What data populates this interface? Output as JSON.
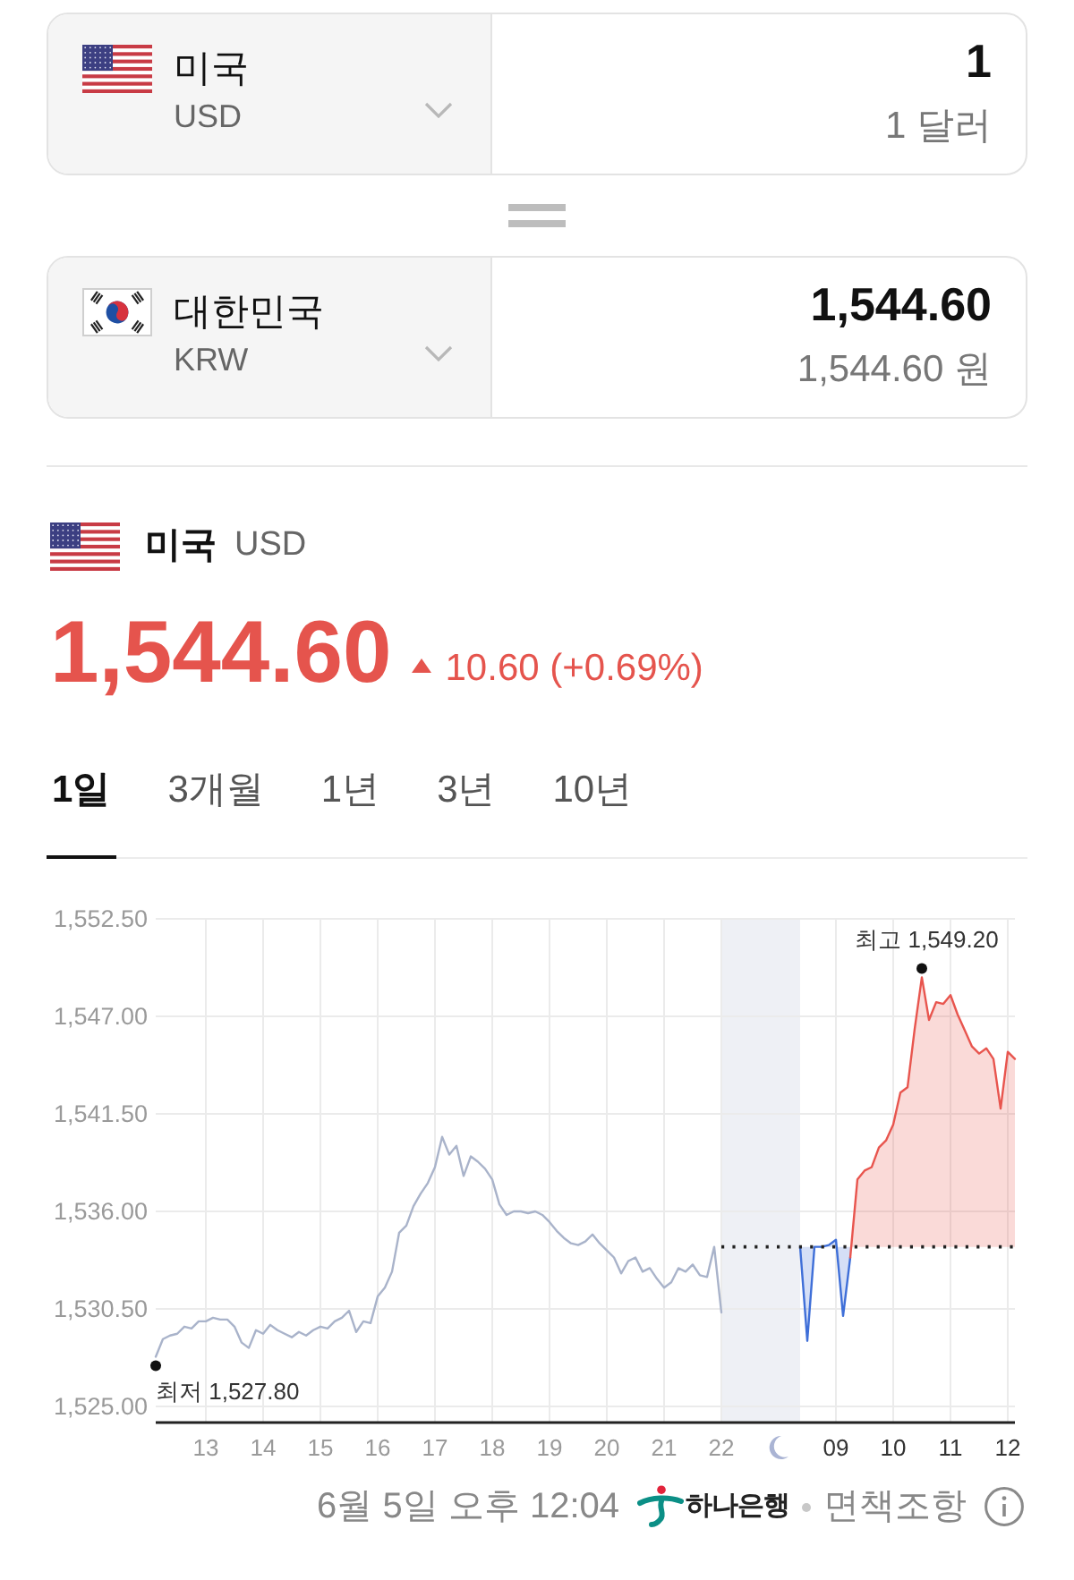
{
  "converter": [
    {
      "name": "미국",
      "code": "USD",
      "amount": "1",
      "amount_text": "1 달러"
    },
    {
      "name": "대한민국",
      "code": "KRW",
      "amount": "1,544.60",
      "amount_text": "1,544.60 원"
    }
  ],
  "quote": {
    "name": "미국",
    "code": "USD",
    "price": "1,544.60",
    "rising": true,
    "change": "10.60 (+0.69%)"
  },
  "tabs": [
    {
      "label": "1일",
      "selected": true
    },
    {
      "label": "3개월",
      "selected": false
    },
    {
      "label": "1년",
      "selected": false
    },
    {
      "label": "3년",
      "selected": false
    },
    {
      "label": "10년",
      "selected": false
    }
  ],
  "chart": {
    "chart_data": {
      "type": "line",
      "grid": true,
      "categories": [
        null,
        null,
        null,
        null,
        null,
        null,
        null,
        "13",
        null,
        null,
        null,
        null,
        null,
        null,
        null,
        "14",
        null,
        null,
        null,
        null,
        null,
        null,
        null,
        "15",
        null,
        null,
        null,
        null,
        null,
        null,
        null,
        "16",
        null,
        null,
        null,
        null,
        null,
        null,
        null,
        "17",
        null,
        null,
        null,
        null,
        null,
        null,
        null,
        "18",
        null,
        null,
        null,
        null,
        null,
        null,
        null,
        "19",
        null,
        null,
        null,
        null,
        null,
        null,
        null,
        "20",
        null,
        null,
        null,
        null,
        null,
        null,
        null,
        "21",
        null,
        null,
        null,
        null,
        null,
        null,
        null,
        "22",
        null,
        null,
        null,
        null,
        null,
        null,
        null,
        null,
        null,
        null,
        null,
        null,
        null,
        null,
        null,
        "09",
        null,
        null,
        null,
        null,
        null,
        null,
        null,
        "10",
        null,
        null,
        null,
        null,
        null,
        null,
        null,
        "11",
        null,
        null,
        null,
        null,
        null,
        null,
        null,
        "12",
        null
      ],
      "series": [
        {
          "color": "#a9b3ca",
          "values": [
            1527.8,
            1528.8,
            1529.0,
            1529.1,
            1529.5,
            1529.4,
            1529.8,
            1529.8,
            1530.0,
            1529.9,
            1529.9,
            1529.5,
            1528.6,
            1528.3,
            1529.3,
            1529.1,
            1529.6,
            1529.3,
            1529.1,
            1528.9,
            1529.2,
            1529.0,
            1529.3,
            1529.5,
            1529.4,
            1529.8,
            1530.0,
            1530.4,
            1529.2,
            1529.8,
            1529.7,
            1531.2,
            1531.7,
            1532.6,
            1534.8,
            1535.2,
            1536.3,
            1537.0,
            1537.6,
            1538.5,
            1540.2,
            1539.2,
            1539.7,
            1538.0,
            1539.1,
            1538.8,
            1538.4,
            1537.8,
            1536.4,
            1535.8,
            1536.0,
            1536.0,
            1535.9,
            1536.0,
            1535.8,
            1535.4,
            1534.9,
            1534.5,
            1534.2,
            1534.1,
            1534.3,
            1534.7,
            1534.2,
            1533.8,
            1533.4,
            1532.5,
            1533.2,
            1533.4,
            1532.6,
            1532.8,
            1532.2,
            1531.7,
            1532.0,
            1532.8,
            1532.6,
            1533.0,
            1532.4,
            1532.3,
            1534.0,
            1530.3,
            null,
            null,
            null,
            null,
            null,
            null,
            null,
            null,
            null,
            null,
            null,
            null,
            null,
            null,
            null,
            null,
            null,
            null,
            null,
            null,
            null,
            null,
            null,
            null,
            null,
            null,
            null,
            null,
            null,
            null,
            null,
            null,
            null,
            null,
            null,
            null,
            null,
            null,
            null,
            null,
            null
          ]
        },
        {
          "color": "#3f6fd8",
          "values": [
            null,
            null,
            null,
            null,
            null,
            null,
            null,
            null,
            null,
            null,
            null,
            null,
            null,
            null,
            null,
            null,
            null,
            null,
            null,
            null,
            null,
            null,
            null,
            null,
            null,
            null,
            null,
            null,
            null,
            null,
            null,
            null,
            null,
            null,
            null,
            null,
            null,
            null,
            null,
            null,
            null,
            null,
            null,
            null,
            null,
            null,
            null,
            null,
            null,
            null,
            null,
            null,
            null,
            null,
            null,
            null,
            null,
            null,
            null,
            null,
            null,
            null,
            null,
            null,
            null,
            null,
            null,
            null,
            null,
            null,
            null,
            null,
            null,
            null,
            null,
            null,
            null,
            null,
            null,
            null,
            null,
            null,
            null,
            null,
            null,
            null,
            null,
            null,
            null,
            null,
            1534.0,
            1528.7,
            1534.0,
            1534.0,
            1534.1,
            1534.4,
            1530.1,
            1533.4,
            null,
            null,
            null,
            null,
            null,
            null,
            null,
            null,
            null,
            null,
            null,
            null,
            null,
            null,
            null,
            null,
            null,
            null,
            null,
            null,
            null,
            null,
            null
          ]
        },
        {
          "color": "#e8554e",
          "values": [
            null,
            null,
            null,
            null,
            null,
            null,
            null,
            null,
            null,
            null,
            null,
            null,
            null,
            null,
            null,
            null,
            null,
            null,
            null,
            null,
            null,
            null,
            null,
            null,
            null,
            null,
            null,
            null,
            null,
            null,
            null,
            null,
            null,
            null,
            null,
            null,
            null,
            null,
            null,
            null,
            null,
            null,
            null,
            null,
            null,
            null,
            null,
            null,
            null,
            null,
            null,
            null,
            null,
            null,
            null,
            null,
            null,
            null,
            null,
            null,
            null,
            null,
            null,
            null,
            null,
            null,
            null,
            null,
            null,
            null,
            null,
            null,
            null,
            null,
            null,
            null,
            null,
            null,
            null,
            null,
            null,
            null,
            null,
            null,
            null,
            null,
            null,
            null,
            null,
            null,
            null,
            null,
            null,
            null,
            null,
            null,
            null,
            1533.4,
            1537.8,
            1538.3,
            1538.5,
            1539.6,
            1540.0,
            1540.9,
            1542.7,
            1543.0,
            1546.3,
            1549.2,
            1546.8,
            1547.8,
            1547.7,
            1548.2,
            1547.1,
            1546.2,
            1545.3,
            1544.9,
            1545.2,
            1544.6,
            1541.8,
            1545.0,
            1544.6
          ]
        }
      ],
      "ylim": [
        1525,
        1552.5
      ],
      "yticks": [
        {
          "value": 1525,
          "label": "1,525.00"
        },
        {
          "value": 1530.5,
          "label": "1,530.50"
        },
        {
          "value": 1536,
          "label": "1,536.00"
        },
        {
          "value": 1541.5,
          "label": "1,541.50"
        },
        {
          "value": 1547,
          "label": "1,547.00"
        },
        {
          "value": 1552.5,
          "label": "1,552.50"
        }
      ],
      "ref_lines": [
        {
          "axis": "y",
          "value": 1534.0
        }
      ],
      "annotations": [
        "최저 1,527.80",
        {
          "y": 1549.2,
          "text": "최고 1,549.20"
        }
      ]
    }
  },
  "footer": {
    "updated": "6월 5일 오후 12:04",
    "provider": "하나은행",
    "disclaimer": "면책조항"
  }
}
